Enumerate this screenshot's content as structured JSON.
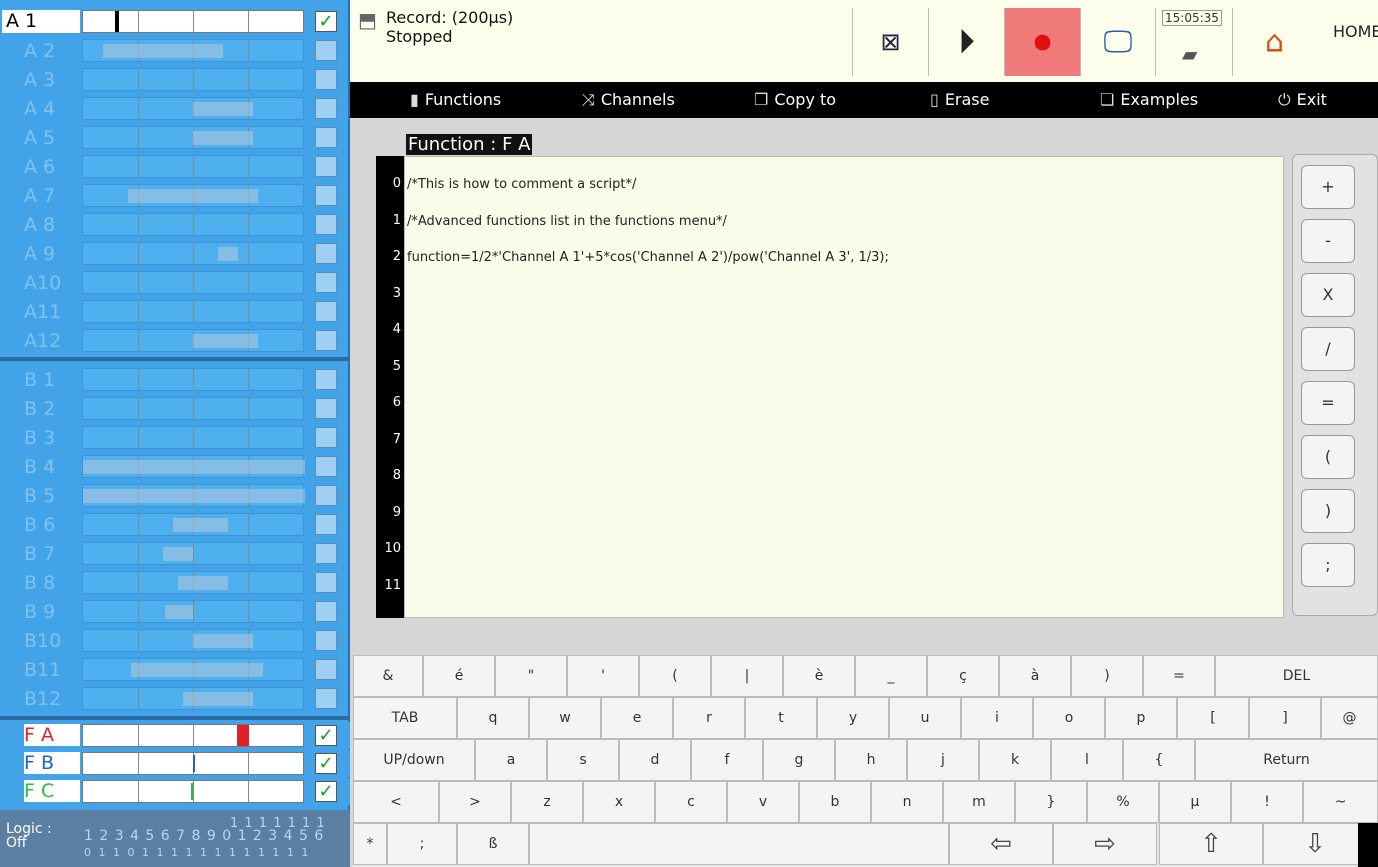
{
  "channels_a": [
    "A 1",
    "A 2",
    "A 3",
    "A 4",
    "A 5",
    "A 6",
    "A 7",
    "A 8",
    "A 9",
    "A10",
    "A11",
    "A12"
  ],
  "channels_b": [
    "B 1",
    "B 2",
    "B 3",
    "B 4",
    "B 5",
    "B 6",
    "B 7",
    "B 8",
    "B 9",
    "B10",
    "B11",
    "B12"
  ],
  "functions": [
    "F A",
    "F B",
    "F C"
  ],
  "functions_colors": [
    "#e0202a",
    "#2060e0",
    "#20c040"
  ],
  "checkmark": "✓",
  "logic": {
    "label1": "Logic :",
    "label2": "Off",
    "digits": "1 2 3 4 5 6 7 8 9 0 1 2 3 4 5 6",
    "tens": "1 1 1 1 1 1 1",
    "bits": "0 1 1 0 1 1 1 1 1 1 1 1 1 1 1 1"
  },
  "status": {
    "line1": "Record: (200µs)",
    "line2": "Stopped"
  },
  "clock": "15:05:35",
  "home": "HOME",
  "menu": {
    "functions": "Functions",
    "channels": "Channels",
    "copy_to": "Copy to",
    "erase": "Erase",
    "examples": "Examples",
    "exit": "Exit"
  },
  "editor": {
    "title": "Function : F A",
    "line_numbers": [
      "0",
      "1",
      "2",
      "3",
      "4",
      "5",
      "6",
      "7",
      "8",
      "9",
      "10",
      "11"
    ],
    "lines": [
      "/*This is how to comment a script*/",
      "/*Advanced functions list in the functions menu*/",
      "function=1/2*'Channel A 1'+5*cos('Channel A 2')/pow('Channel A 3', 1/3);"
    ]
  },
  "operator_keys": [
    "+",
    "-",
    "X",
    "/",
    "=",
    "(",
    ")",
    ";"
  ],
  "keyboard": {
    "row1": [
      "&",
      "é",
      "\"",
      "'",
      "(",
      "|",
      "è",
      "_",
      "ç",
      "à",
      ")",
      "=",
      "DEL"
    ],
    "row2": [
      "TAB",
      "q",
      "w",
      "e",
      "r",
      "t",
      "y",
      "u",
      "i",
      "o",
      "p",
      "[",
      "]",
      "@"
    ],
    "row3": [
      "UP/down",
      "a",
      "s",
      "d",
      "f",
      "g",
      "h",
      "j",
      "k",
      "l",
      "{",
      "Return"
    ],
    "row4": [
      "<",
      ">",
      "z",
      "x",
      "c",
      "v",
      "b",
      "n",
      "m",
      "}",
      "%",
      "µ",
      "!",
      "~"
    ],
    "row5": [
      "*",
      ";",
      "ß"
    ]
  }
}
